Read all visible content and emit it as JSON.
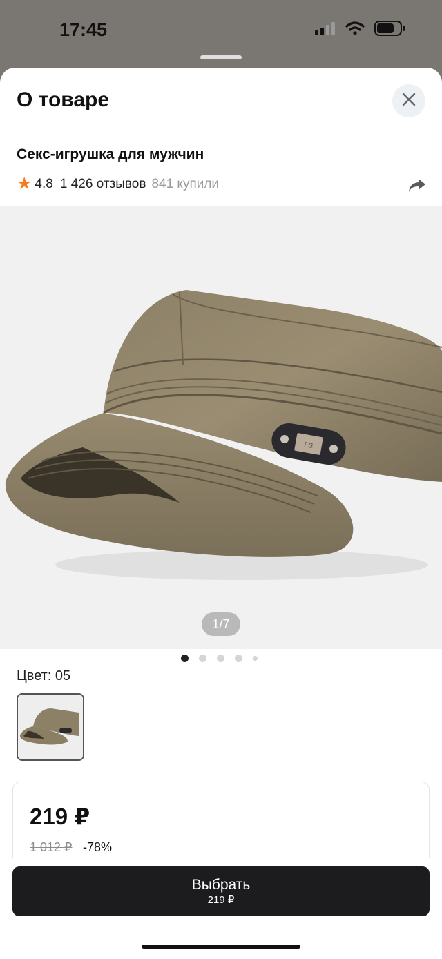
{
  "status_bar": {
    "time": "17:45",
    "icons": [
      "signal-icon",
      "wifi-icon",
      "battery-icon"
    ]
  },
  "sheet": {
    "title": "О товаре",
    "close_icon": "close-icon",
    "product_name": "Секс-игрушка для мужчин",
    "rating": "4.8",
    "reviews": "1 426 отзывов",
    "bought": "841 купили",
    "share_icon": "share-icon"
  },
  "gallery": {
    "image": "khaki-military-cap",
    "counter": "1/7",
    "dots": 5,
    "active_dot": 1
  },
  "color": {
    "label": "Цвет: 05"
  },
  "price": {
    "current": "219 ₽",
    "old": "1 012 ₽",
    "discount": "-78%"
  },
  "action": {
    "label": "Выбрать",
    "price": "219 ₽"
  },
  "colors": {
    "accent_star": "#f57c1f",
    "button_bg": "#1c1c1e",
    "backdrop": "#7a7672"
  }
}
